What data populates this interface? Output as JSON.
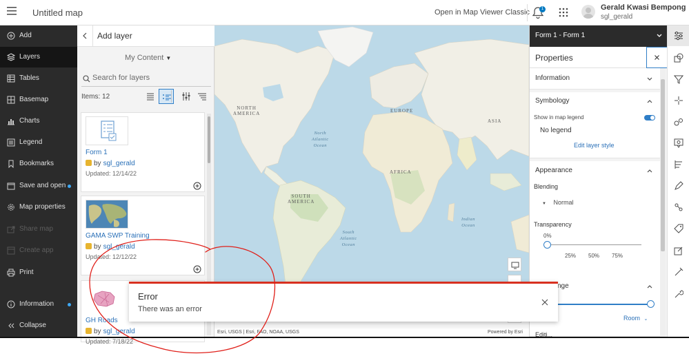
{
  "header": {
    "app_title": "Untitled map",
    "classic_link": "Open in Map Viewer Classic",
    "notification_count": "1",
    "user_name": "Gerald Kwasi Bempong",
    "user_id": "sgl_gerald"
  },
  "nav": {
    "items": [
      {
        "label": "Add",
        "icon": "add-icon"
      },
      {
        "label": "Layers",
        "icon": "layers-icon",
        "active": true
      },
      {
        "label": "Tables",
        "icon": "tables-icon"
      },
      {
        "label": "Basemap",
        "icon": "basemap-icon"
      },
      {
        "label": "Charts",
        "icon": "charts-icon"
      },
      {
        "label": "Legend",
        "icon": "legend-icon"
      },
      {
        "label": "Bookmarks",
        "icon": "bookmarks-icon"
      },
      {
        "label": "Save and open",
        "icon": "save-icon",
        "dot": true
      },
      {
        "label": "Map properties",
        "icon": "gear-icon"
      },
      {
        "label": "Share map",
        "icon": "share-icon",
        "disabled": true
      },
      {
        "label": "Create app",
        "icon": "app-icon",
        "disabled": true
      },
      {
        "label": "Print",
        "icon": "print-icon"
      }
    ],
    "information": "Information",
    "collapse": "Collapse"
  },
  "add_layer": {
    "title": "Add layer",
    "content_source": "My Content",
    "search_placeholder": "Search for layers",
    "items_count": "Items: 12",
    "by_label": "by",
    "add_icon": "plus-circle-icon",
    "cards": [
      {
        "name": "Form 1",
        "owner": "sgl_gerald",
        "updated": "Updated: 12/14/22",
        "thumb": "form-thumbnail"
      },
      {
        "name": "GAMA SWP Training",
        "owner": "sgl_gerald",
        "updated": "Updated: 12/12/22",
        "thumb": "map-thumbnail"
      },
      {
        "name": "GH Roads",
        "owner": "sgl_gerald",
        "updated": "Updated: 7/18/22",
        "thumb": "roads-thumbnail"
      }
    ]
  },
  "map": {
    "labels": {
      "north_america": "NORTH\nAMERICA",
      "south_america": "SOUTH\nAMERICA",
      "europe": "EUROPE",
      "asia": "ASIA",
      "africa": "AFRICA",
      "north_atlantic": "North\nAtlantic\nOcean",
      "south_atlantic": "South\nAtlantic\nOcean",
      "indian_ocean": "Indian\nOcean"
    },
    "attribution": "Esri, USGS | Esri, FAO, NOAA, USGS",
    "powered_by": "Powered by Esri"
  },
  "properties": {
    "layer_select": "Form 1 - Form 1",
    "title": "Properties",
    "information": "Information",
    "symbology": "Symbology",
    "show_legend": "Show in map legend",
    "show_legend_on": true,
    "no_legend": "No legend",
    "edit_style": "Edit layer style",
    "appearance": "Appearance",
    "blending": "Blending",
    "blending_value": "Normal",
    "transparency": "Transparency",
    "transparency_value": "0%",
    "transparency_ticks": [
      "25%",
      "50%",
      "75%"
    ],
    "visible_range_partial": "nge",
    "range_value": "Room",
    "next_section_partial": "Editi..."
  },
  "error": {
    "title": "Error",
    "message": "There was an error"
  },
  "colors": {
    "accent": "#2f7ec7",
    "nav_bg": "#2b2b2b",
    "error_red": "#d83020",
    "annotation_red": "#e0201a"
  }
}
